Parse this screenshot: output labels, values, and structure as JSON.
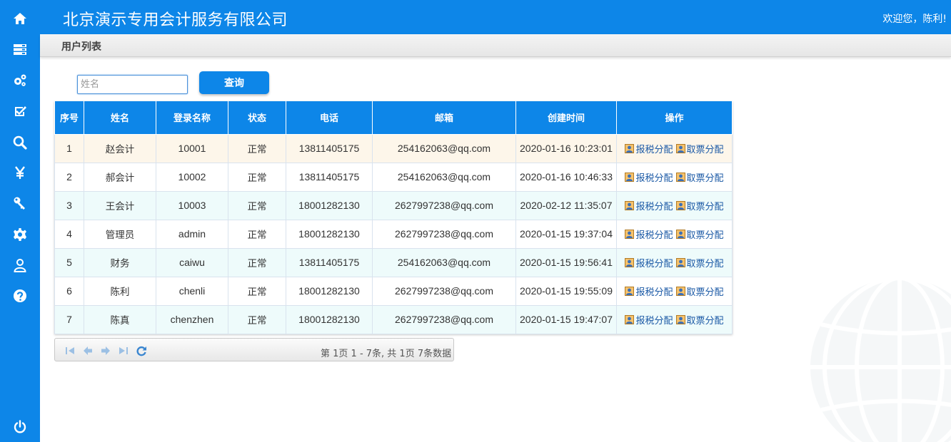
{
  "header": {
    "company": "北京演示专用会计服务有限公司",
    "welcome": "欢迎您，陈利!"
  },
  "breadcrumb": {
    "title": "用户列表"
  },
  "search": {
    "placeholder": "姓名",
    "value": "",
    "button_label": "查询"
  },
  "sidebar": {
    "items": [
      {
        "icon": "home-icon"
      },
      {
        "icon": "list-icon"
      },
      {
        "icon": "gears-icon"
      },
      {
        "icon": "checkbox-icon"
      },
      {
        "icon": "search-icon"
      },
      {
        "icon": "yen-icon"
      },
      {
        "icon": "key-icon"
      },
      {
        "icon": "gear-icon"
      },
      {
        "icon": "user-icon"
      },
      {
        "icon": "help-icon"
      },
      {
        "icon": "power-icon"
      }
    ]
  },
  "table": {
    "columns": [
      "序号",
      "姓名",
      "登录名称",
      "状态",
      "电话",
      "邮箱",
      "创建时间",
      "操作"
    ],
    "op_labels": {
      "tax": "报税分配",
      "invoice": "取票分配"
    },
    "rows": [
      {
        "no": "1",
        "name": "赵会计",
        "login": "10001",
        "status": "正常",
        "phone": "13811405175",
        "email": "254162063@qq.com",
        "created": "2020-01-16 10:23:01"
      },
      {
        "no": "2",
        "name": "郝会计",
        "login": "10002",
        "status": "正常",
        "phone": "13811405175",
        "email": "254162063@qq.com",
        "created": "2020-01-16 10:46:33"
      },
      {
        "no": "3",
        "name": "王会计",
        "login": "10003",
        "status": "正常",
        "phone": "18001282130",
        "email": "2627997238@qq.com",
        "created": "2020-02-12 11:35:07"
      },
      {
        "no": "4",
        "name": "管理员",
        "login": "admin",
        "status": "正常",
        "phone": "18001282130",
        "email": "2627997238@qq.com",
        "created": "2020-01-15 19:37:04"
      },
      {
        "no": "5",
        "name": "财务",
        "login": "caiwu",
        "status": "正常",
        "phone": "13811405175",
        "email": "254162063@qq.com",
        "created": "2020-01-15 19:56:41"
      },
      {
        "no": "6",
        "name": "陈利",
        "login": "chenli",
        "status": "正常",
        "phone": "18001282130",
        "email": "2627997238@qq.com",
        "created": "2020-01-15 19:55:09"
      },
      {
        "no": "7",
        "name": "陈真",
        "login": "chenzhen",
        "status": "正常",
        "phone": "18001282130",
        "email": "2627997238@qq.com",
        "created": "2020-01-15 19:47:07"
      }
    ]
  },
  "pager": {
    "info": "第 1页 1 - 7条, 共 1页 7条数据"
  },
  "colors": {
    "primary": "#0d86e8",
    "row_highlight": "#fdf6ea",
    "row_alt": "#eefbfb",
    "link": "#1c5aa6"
  }
}
